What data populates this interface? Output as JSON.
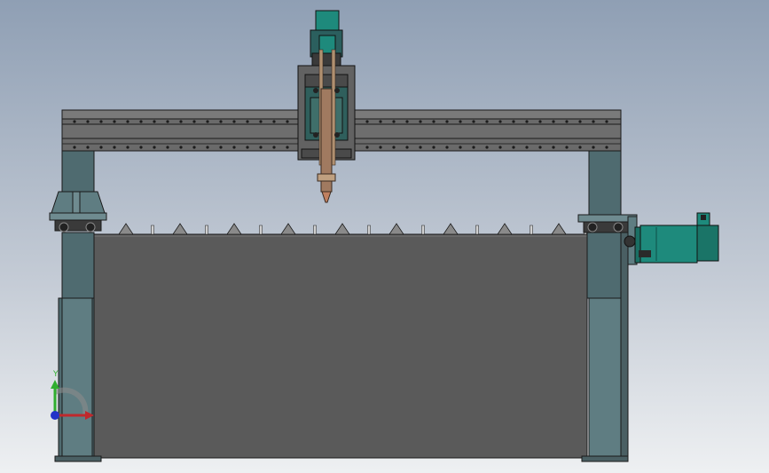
{
  "viewport": {
    "name": "cad-viewport"
  },
  "colors": {
    "background_top": "#8f9fb4",
    "background_bottom": "#eef0f2",
    "frame_teal": "#4f6b70",
    "frame_teal_light": "#5f7d82",
    "table_gray": "#5a5a5a",
    "gantry_gray": "#6a6a6a",
    "copper": "#a07a60",
    "motor_green": "#1e8a7c",
    "edge": "#1a1a1a"
  },
  "triad": {
    "y_label": "Y",
    "x_label": "",
    "y_color": "#2fae2f",
    "x_color": "#c0282c",
    "z_color": "#2232c8"
  },
  "slats": {
    "count": 9,
    "stakes": 9
  }
}
